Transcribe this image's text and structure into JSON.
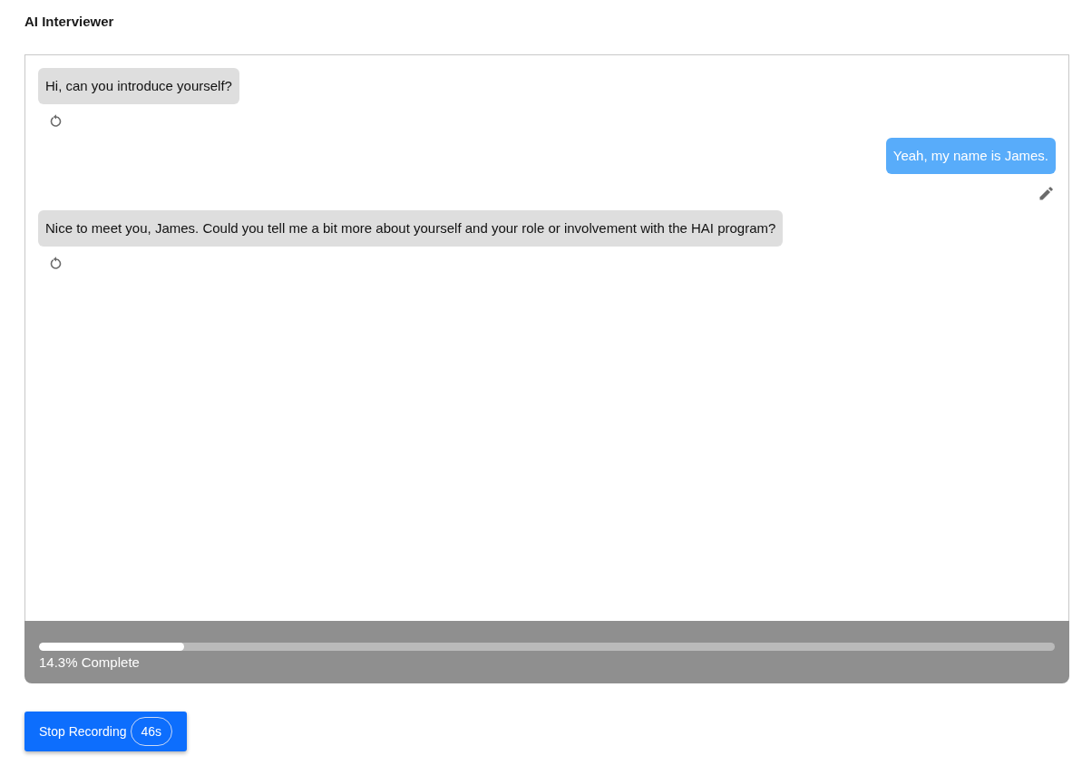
{
  "title": "AI Interviewer",
  "messages": [
    {
      "kind": "assistant",
      "text": "Hi, can you introduce yourself?"
    },
    {
      "kind": "user",
      "text": "Yeah, my name is James."
    },
    {
      "kind": "assistant",
      "text": "Nice to meet you, James. Could you tell me a bit more about yourself and your role or involvement with the HAI program?"
    }
  ],
  "progress": {
    "level": 0.143,
    "label": "14.3% Complete"
  },
  "record_button": {
    "label": "Stop Recording",
    "timer": "46s"
  }
}
